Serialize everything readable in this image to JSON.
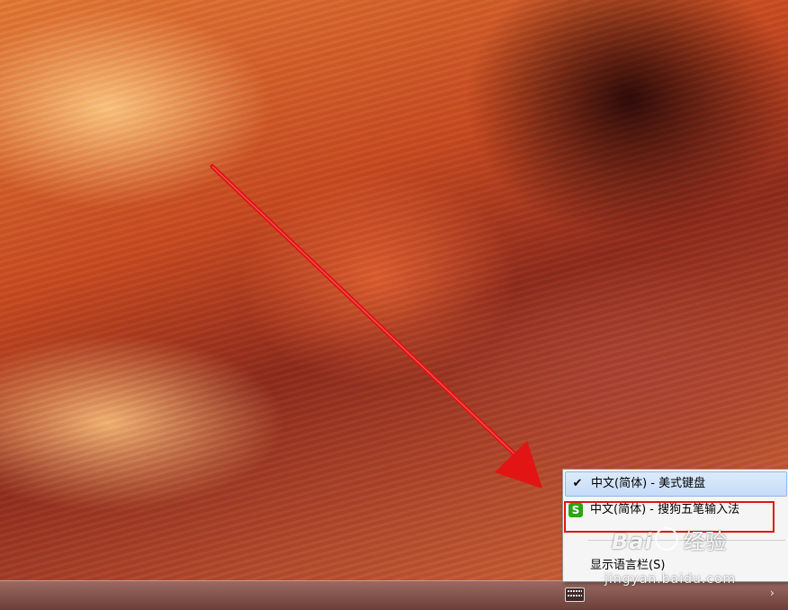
{
  "language_menu": {
    "items": [
      {
        "label": "中文(简体) - 美式键盘",
        "checked": true,
        "icon": "check-icon"
      },
      {
        "label": "中文(简体) - 搜狗五笔输入法",
        "checked": false,
        "icon": "sogou-s-icon",
        "icon_letter": "S"
      }
    ],
    "show_language_bar": "显示语言栏(S)"
  },
  "watermark": {
    "logo": "Bai",
    "brand": "经验",
    "url": "jingyan.baidu.com"
  },
  "taskbar": {
    "tray_chevron": "›"
  },
  "colors": {
    "annotation_red": "#e31414",
    "menu_highlight": "#c5dcf7",
    "sogou_green": "#2aa515"
  }
}
